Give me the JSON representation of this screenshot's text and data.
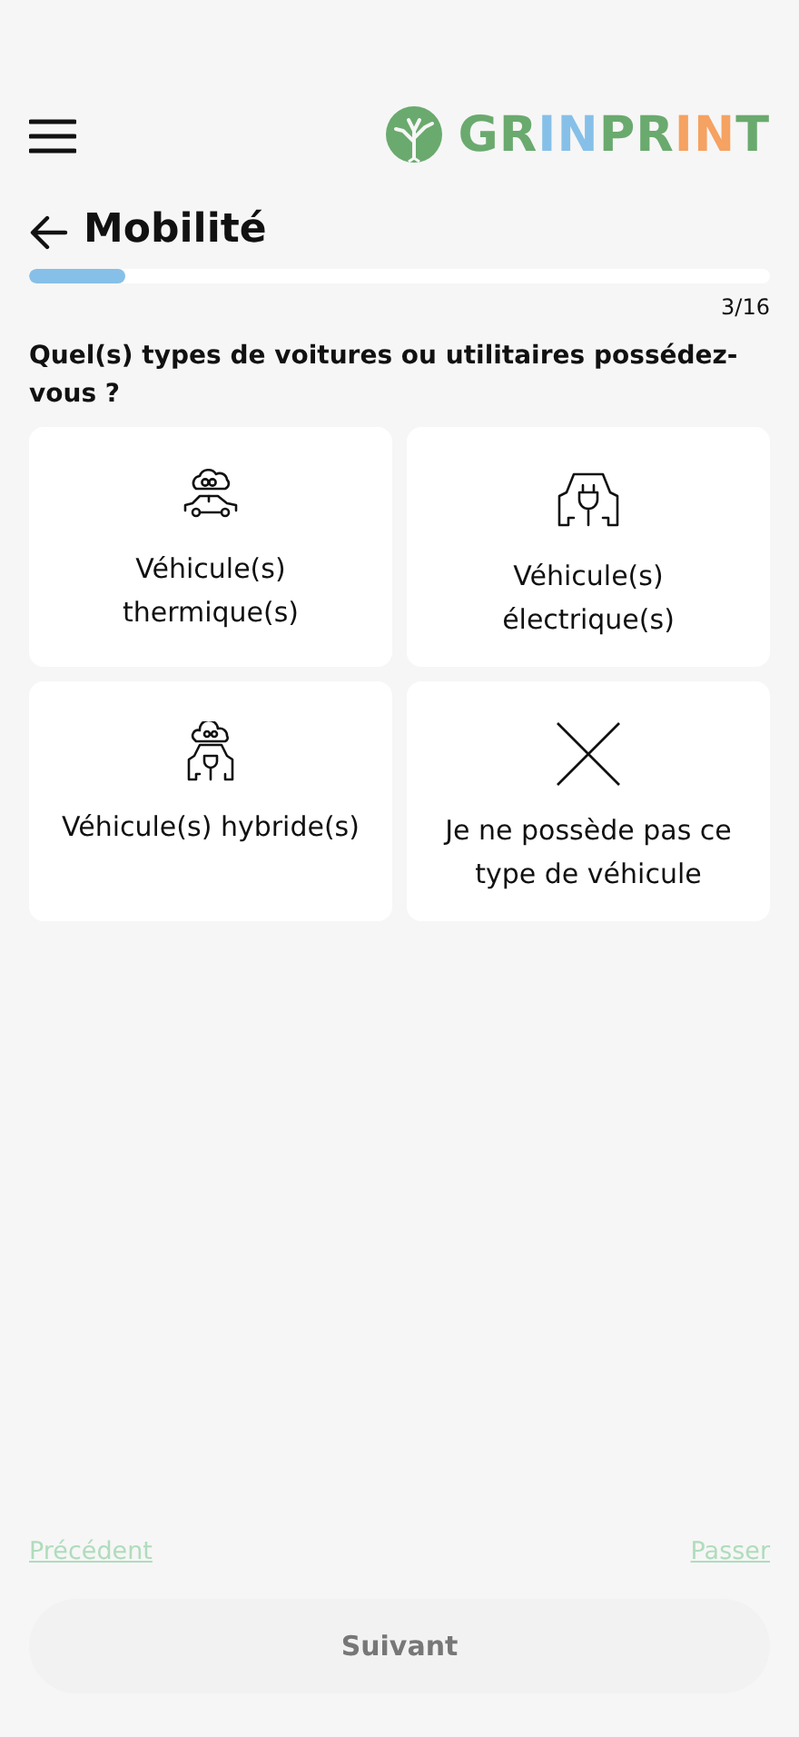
{
  "header": {
    "logo_parts": [
      {
        "text": "GR",
        "color": "#6aaa6e"
      },
      {
        "text": "IN",
        "color": "#86c0e8"
      },
      {
        "text": "PR",
        "color": "#6aaa6e"
      },
      {
        "text": "IN",
        "color": "#f5a262"
      },
      {
        "text": "T",
        "color": "#6aaa6e"
      }
    ]
  },
  "title": "Mobilité",
  "progress": {
    "level": 0.13,
    "reading": "3/16"
  },
  "question": "Quel(s) types de voitures ou utilitaires possédez-vous ?",
  "options": [
    {
      "kind": "thermal",
      "label": "Véhicule(s) thermique(s)",
      "selected": false
    },
    {
      "kind": "electric",
      "label": "Véhicule(s) électrique(s)",
      "selected": false
    },
    {
      "kind": "hybrid",
      "label": "Véhicule(s) hybride(s)",
      "selected": false
    },
    {
      "kind": "none",
      "label": "Je ne possède pas ce type de véhicule",
      "selected": false
    }
  ],
  "footer": {
    "previous": "Précédent",
    "skip": "Passer",
    "next": {
      "label": "Suivant",
      "disabled": true
    }
  }
}
